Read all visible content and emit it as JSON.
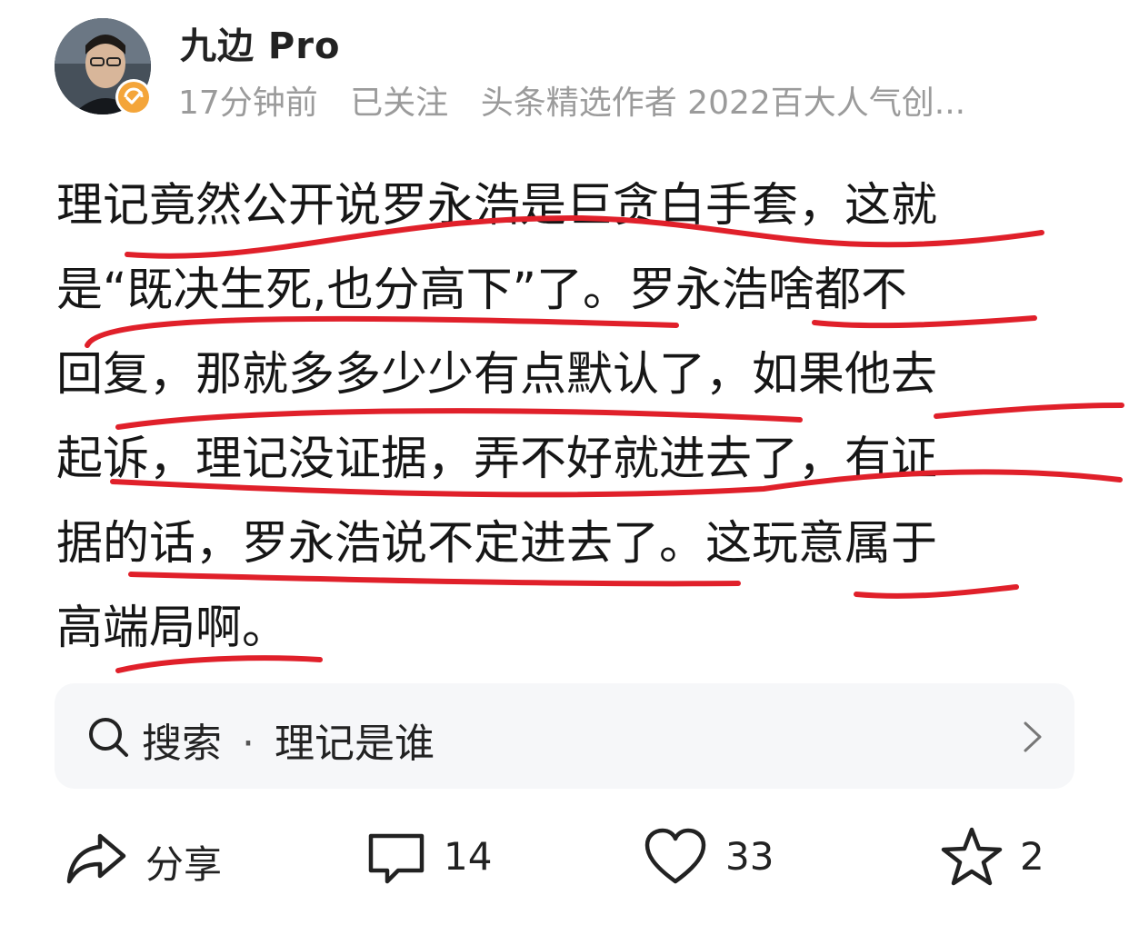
{
  "author": {
    "name": "九边 Pro",
    "meta": [
      "17分钟前",
      "已关注",
      "头条精选作者 2022百大人气创..."
    ]
  },
  "post": {
    "lines": [
      "理记竟然公开说罗永浩是巨贪白手套，这就",
      "是“既决生死,也分高下”了。罗永浩啥都不",
      "回复，那就多多少少有点默认了，如果他去",
      "起诉，理记没证据，弄不好就进去了，有证",
      "据的话，罗永浩说不定进去了。这玩意属于",
      "高端局啊。"
    ]
  },
  "search": {
    "prefix": "搜索",
    "separator": "·",
    "query": "理记是谁"
  },
  "actions": {
    "share_label": "分享",
    "comment_count": "14",
    "like_count": "33",
    "favorite_count": "2"
  },
  "colors": {
    "underline_red": "#e0202a",
    "badge_orange": "#f4a53a",
    "meta_gray": "#9b9b9b",
    "search_bg": "#f6f7f9"
  }
}
